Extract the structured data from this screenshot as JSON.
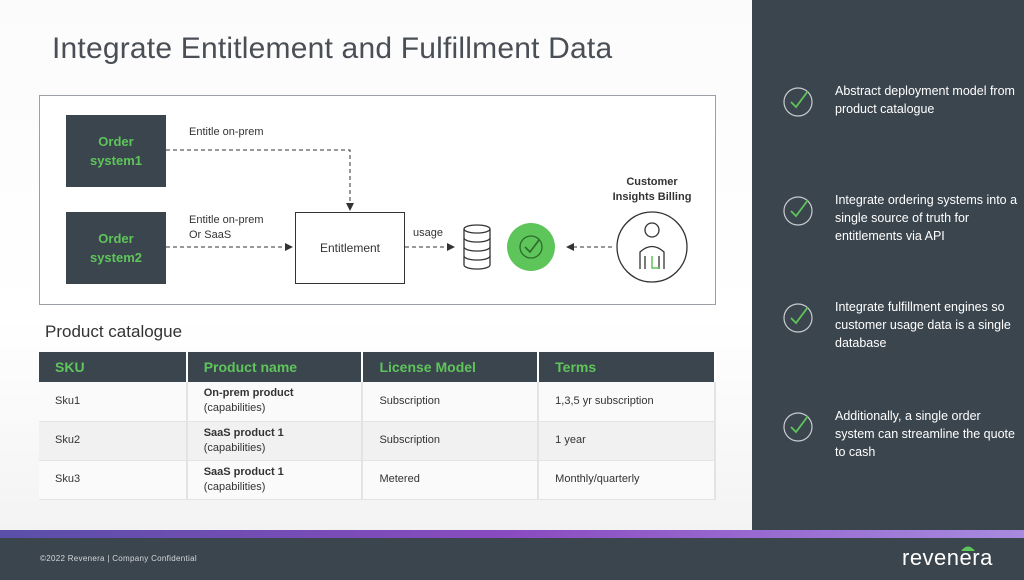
{
  "slide": {
    "title": "Integrate Entitlement and Fulfillment Data"
  },
  "diagram": {
    "order_system_1": "Order system1",
    "order_system_2": "Order system2",
    "entitlement": "Entitlement",
    "label_onprem": "Entitle on-prem",
    "label_onprem_saas_1": "Entitle on-prem",
    "label_onprem_saas_2": "Or SaaS",
    "label_usage": "usage",
    "customer_label_1": "Customer",
    "customer_label_2": "Insights Billing",
    "icons": [
      "database-icon",
      "check-circle-icon",
      "user-icon"
    ],
    "check_color": "#5ec55a"
  },
  "catalogue": {
    "title": "Product catalogue",
    "headers": [
      "SKU",
      "Product name",
      "License Model",
      "Terms"
    ],
    "rows": [
      {
        "sku": "Sku1",
        "product": "On-prem product",
        "capabilities": "(capabilities)",
        "license": "Subscription",
        "terms": "1,3,5 yr subscription"
      },
      {
        "sku": "Sku2",
        "product": "SaaS product 1",
        "capabilities": "(capabilities)",
        "license": "Subscription",
        "terms": "1 year"
      },
      {
        "sku": "Sku3",
        "product": "SaaS product 1",
        "capabilities": "(capabilities)",
        "license": "Metered",
        "terms": "Monthly/quarterly"
      }
    ]
  },
  "sidebar": {
    "items": [
      {
        "text": "Abstract deployment model from product catalogue",
        "icon": "check-circle-icon"
      },
      {
        "text": "Integrate ordering systems into a single source of truth for entitlements via API",
        "icon": "check-circle-icon"
      },
      {
        "text": "Integrate fulfillment engines so customer usage data is a single database",
        "icon": "check-circle-icon"
      },
      {
        "text": "Additionally, a single order system can streamline the quote to cash",
        "icon": "check-circle-icon"
      }
    ]
  },
  "footer": {
    "copyright": "©2022 Revenera | Company Confidential",
    "logo": "revenera"
  },
  "colors": {
    "accent_green": "#5ec55a",
    "dark_panel": "#3b454e"
  }
}
